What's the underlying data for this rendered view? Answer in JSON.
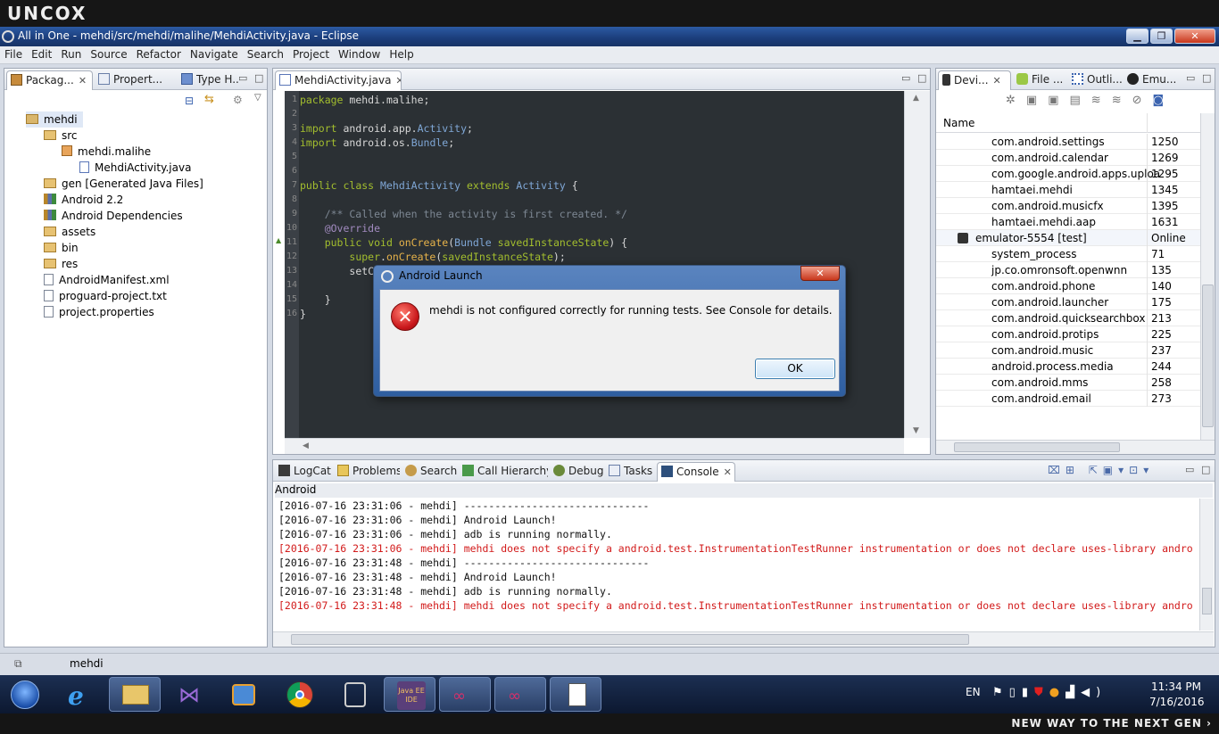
{
  "brand": {
    "logo": "UNCOX",
    "footer_slogan": "NEW WAY TO THE NEXT GEN ›"
  },
  "window": {
    "title": "All in One - mehdi/src/mehdi/malihe/MehdiActivity.java - Eclipse",
    "minimize": "▁",
    "maximize": "❐",
    "close": "✕"
  },
  "menu": [
    "File",
    "Edit",
    "Run",
    "Source",
    "Refactor",
    "Navigate",
    "Search",
    "Project",
    "Window",
    "Help"
  ],
  "left_panel": {
    "tabs": [
      {
        "label": "Packag...",
        "icon": "package-explorer-icon"
      },
      {
        "label": "Propert...",
        "icon": "properties-icon"
      },
      {
        "label": "Type H...",
        "icon": "type-hierarchy-icon"
      }
    ],
    "tree": [
      {
        "label": "mehdi",
        "kind": "project",
        "level": 0
      },
      {
        "label": "src",
        "kind": "folder",
        "level": 1
      },
      {
        "label": "mehdi.malihe",
        "kind": "package",
        "level": 2
      },
      {
        "label": "MehdiActivity.java",
        "kind": "java",
        "level": 3
      },
      {
        "label": "gen [Generated Java Files]",
        "kind": "folder",
        "level": 1
      },
      {
        "label": "Android 2.2",
        "kind": "library",
        "level": 1
      },
      {
        "label": "Android Dependencies",
        "kind": "library",
        "level": 1
      },
      {
        "label": "assets",
        "kind": "folder",
        "level": 1
      },
      {
        "label": "bin",
        "kind": "folder",
        "level": 1
      },
      {
        "label": "res",
        "kind": "folder",
        "level": 1
      },
      {
        "label": "AndroidManifest.xml",
        "kind": "file",
        "level": 1
      },
      {
        "label": "proguard-project.txt",
        "kind": "file",
        "level": 1
      },
      {
        "label": "project.properties",
        "kind": "file",
        "level": 1
      }
    ]
  },
  "editor": {
    "tab": "MehdiActivity.java",
    "lines": [
      "package mehdi.malihe;",
      "",
      "import android.app.Activity;",
      "import android.os.Bundle;",
      "",
      "",
      "public class MehdiActivity extends Activity {",
      "",
      "    /** Called when the activity is first created. */",
      "    @Override",
      "    public void onCreate(Bundle savedInstanceState) {",
      "        super.onCreate(savedInstanceState);",
      "        setC",
      "",
      "    }",
      "}"
    ]
  },
  "devices_panel": {
    "tabs": [
      {
        "label": "Devi...",
        "icon": "devices-icon"
      },
      {
        "label": "File ...",
        "icon": "file-explorer-icon"
      },
      {
        "label": "Outli...",
        "icon": "outline-icon"
      },
      {
        "label": "Emu...",
        "icon": "emulator-control-icon"
      }
    ],
    "column_name": "Name",
    "rows": [
      {
        "name": "com.android.settings",
        "pid": "1250"
      },
      {
        "name": "com.android.calendar",
        "pid": "1269"
      },
      {
        "name": "com.google.android.apps.uploa",
        "pid": "1295"
      },
      {
        "name": "hamtaei.mehdi",
        "pid": "1345"
      },
      {
        "name": "com.android.musicfx",
        "pid": "1395"
      },
      {
        "name": "hamtaei.mehdi.aap",
        "pid": "1631"
      },
      {
        "name": "emulator-5554 [test]",
        "pid": "Online",
        "device": true
      },
      {
        "name": "system_process",
        "pid": "71"
      },
      {
        "name": "jp.co.omronsoft.openwnn",
        "pid": "135"
      },
      {
        "name": "com.android.phone",
        "pid": "140"
      },
      {
        "name": "com.android.launcher",
        "pid": "175"
      },
      {
        "name": "com.android.quicksearchbox",
        "pid": "213"
      },
      {
        "name": "com.android.protips",
        "pid": "225"
      },
      {
        "name": "com.android.music",
        "pid": "237"
      },
      {
        "name": "android.process.media",
        "pid": "244"
      },
      {
        "name": "com.android.mms",
        "pid": "258"
      },
      {
        "name": "com.android.email",
        "pid": "273"
      }
    ]
  },
  "bottom_panel": {
    "tabs": [
      {
        "label": "LogCat"
      },
      {
        "label": "Problems"
      },
      {
        "label": "Search"
      },
      {
        "label": "Call Hierarchy"
      },
      {
        "label": "Debug"
      },
      {
        "label": "Tasks"
      },
      {
        "label": "Console"
      }
    ],
    "console_title": "Android",
    "lines": [
      {
        "text": "[2016-07-16 23:31:06 - mehdi] ------------------------------",
        "error": false
      },
      {
        "text": "[2016-07-16 23:31:06 - mehdi] Android Launch!",
        "error": false
      },
      {
        "text": "[2016-07-16 23:31:06 - mehdi] adb is running normally.",
        "error": false
      },
      {
        "text": "[2016-07-16 23:31:06 - mehdi] mehdi does not specify a android.test.InstrumentationTestRunner instrumentation or does not declare uses-library andro",
        "error": true
      },
      {
        "text": "[2016-07-16 23:31:48 - mehdi] ------------------------------",
        "error": false
      },
      {
        "text": "[2016-07-16 23:31:48 - mehdi] Android Launch!",
        "error": false
      },
      {
        "text": "[2016-07-16 23:31:48 - mehdi] adb is running normally.",
        "error": false
      },
      {
        "text": "[2016-07-16 23:31:48 - mehdi] mehdi does not specify a android.test.InstrumentationTestRunner instrumentation or does not declare uses-library andro",
        "error": true
      }
    ]
  },
  "statusbar": {
    "text": "mehdi"
  },
  "dialog": {
    "title": "Android Launch",
    "message": "mehdi is not configured correctly for running tests. See Console for details.",
    "ok": "OK",
    "close": "✕"
  },
  "taskbar": {
    "apps": [
      "start-button",
      "internet-explorer",
      "file-explorer",
      "visual-studio",
      "media-player",
      "chrome",
      "device-manager",
      "eclipse-java-ee",
      "app-glasses-1",
      "app-glasses-2",
      "document-app"
    ],
    "lang": "EN",
    "time": "11:34 PM",
    "date": "7/16/2016"
  }
}
